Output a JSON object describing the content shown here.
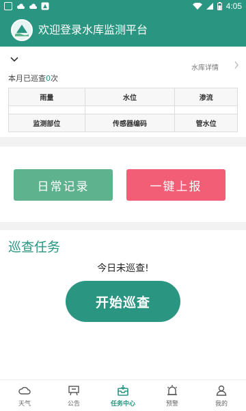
{
  "status_bar": {
    "time": "4:05"
  },
  "app_bar": {
    "title": "欢迎登录水库监测平台"
  },
  "info": {
    "detail_link": "水库详情",
    "patrol_prefix": "本月已巡查",
    "patrol_count": "0",
    "patrol_suffix": "次",
    "table": {
      "row1": [
        "雨量",
        "水位",
        "渗流"
      ],
      "row2": [
        "监测部位",
        "传感器编码",
        "管水位"
      ]
    }
  },
  "actions": {
    "daily_label": "日常记录",
    "report_label": "一键上报"
  },
  "task": {
    "title": "巡查任务",
    "status_text": "今日未巡查!",
    "start_label": "开始巡查"
  },
  "tabbar": {
    "items": [
      {
        "label": "天气",
        "icon": "cloud-icon"
      },
      {
        "label": "公告",
        "icon": "noticeboard-icon"
      },
      {
        "label": "任务中心",
        "icon": "task-inbox-icon"
      },
      {
        "label": "预警",
        "icon": "alarm-icon"
      },
      {
        "label": "我的",
        "icon": "user-icon"
      }
    ],
    "active_index": 2
  },
  "colors": {
    "primary": "#2a9580",
    "daily": "#5fb28e",
    "report": "#f15e76"
  }
}
